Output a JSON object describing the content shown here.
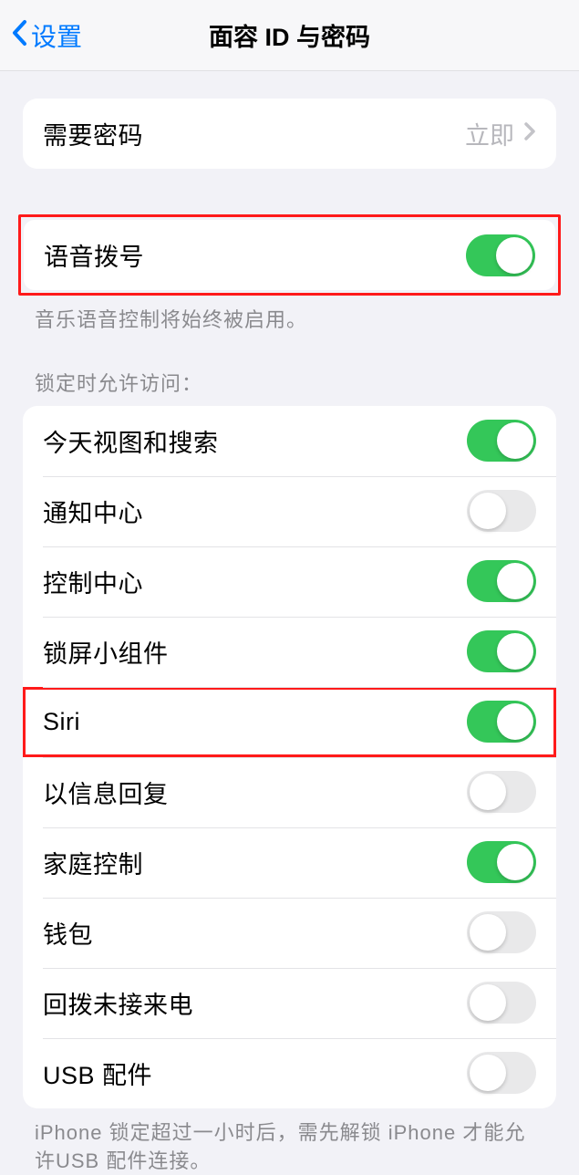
{
  "nav": {
    "back_label": "设置",
    "title": "面容 ID 与密码"
  },
  "passcode_group": {
    "require_label": "需要密码",
    "require_value": "立即"
  },
  "voice_dial": {
    "label": "语音拨号",
    "footer": "音乐语音控制将始终被启用。"
  },
  "lock_access": {
    "header": "锁定时允许访问：",
    "items": [
      {
        "label": "今天视图和搜索",
        "on": true
      },
      {
        "label": "通知中心",
        "on": false
      },
      {
        "label": "控制中心",
        "on": true
      },
      {
        "label": "锁屏小组件",
        "on": true
      },
      {
        "label": "Siri",
        "on": true
      },
      {
        "label": "以信息回复",
        "on": false
      },
      {
        "label": "家庭控制",
        "on": true
      },
      {
        "label": "钱包",
        "on": false
      },
      {
        "label": "回拨未接来电",
        "on": false
      },
      {
        "label": "USB 配件",
        "on": false
      }
    ],
    "footer": "iPhone 锁定超过一小时后，需先解锁 iPhone 才能允许USB 配件连接。"
  }
}
